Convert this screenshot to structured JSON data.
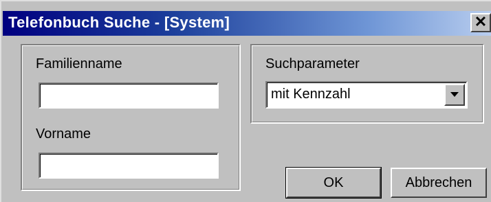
{
  "window": {
    "title": "Telefonbuch Suche - [System]",
    "close_symbol": "✕"
  },
  "name_group": {
    "lastname_label": "Familienname",
    "lastname_value": "",
    "firstname_label": "Vorname",
    "firstname_value": ""
  },
  "search_group": {
    "label": "Suchparameter",
    "selected_option": "mit Kennzahl"
  },
  "buttons": {
    "ok": "OK",
    "cancel": "Abbrechen"
  },
  "icons": {
    "close": "close-icon",
    "dropdown": "chevron-down-icon"
  },
  "colors": {
    "titlebar_start": "#000080",
    "titlebar_end": "#b8cdee",
    "face": "#c0c0c0"
  }
}
